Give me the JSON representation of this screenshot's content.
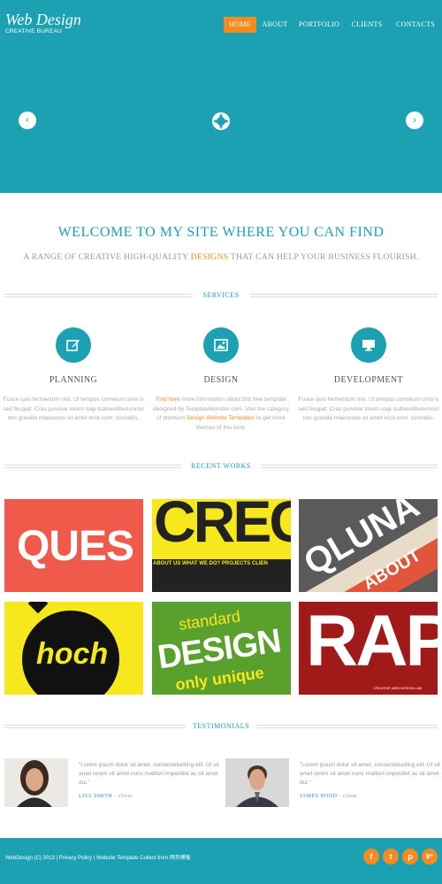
{
  "header": {
    "logo_title": "Web Design",
    "logo_subtitle": "CREATIVE BUREAU",
    "nav": [
      "HOME",
      "ABOUT",
      "PORTFOLIO",
      "CLIENTS",
      "CONTACTS"
    ],
    "active_nav": "HOME"
  },
  "slider": {
    "prev": "‹",
    "next": "›"
  },
  "welcome": {
    "title": "WELCOME TO MY SITE WHERE YOU CAN FIND",
    "sub_before": "A RANGE OF CREATIVE HIGH-QUALITY ",
    "sub_highlight": "DESIGNS",
    "sub_after": " THAT CAN HELP YOUR BUSINESS FLOURISH."
  },
  "services": {
    "heading": "SERVICES",
    "items": [
      {
        "title": "PLANNING",
        "icon": "edit-icon",
        "text": "Fusce quis fermentum nisl. Ut tempus cometum urna is sed feugiat. Cras pulvinar lorem sagi isallvestibulumnisl nec gravida maecenas sit amet eros conr, convallis."
      },
      {
        "title": "DESIGN",
        "icon": "image-icon",
        "link1": "Find here",
        "text_a": " more information about this free template designed by TemplateMonster.com. Visit the category of premium ",
        "link2": "Design Website Templates",
        "text_b": " to get more themes of this kind."
      },
      {
        "title": "DEVELOPMENT",
        "icon": "monitor-icon",
        "text": "Fusce quis fermentum nisl. Ut tempus cometum urna is sed feugiat. Cras pulvinar lorem sagi isallvestibulumnisl nec gravida maecenas sit amet eros conr, convallis."
      }
    ]
  },
  "works": {
    "heading": "RECENT WORKS",
    "items": [
      {
        "text": "QUES",
        "bg": "#f05a4a",
        "fg": "#ffffff"
      },
      {
        "text": "CREC",
        "bg": "#f6e81c",
        "fg": "#222222",
        "nav": "ABOUT US   WHAT WE DO?   PROJECTS   CLIEN"
      },
      {
        "text": "QLUNA",
        "bg": "#444444",
        "fg": "#ffffff",
        "sub": "ABOUT"
      },
      {
        "text": "hoch",
        "bg": "#f6e81c",
        "fg": "#f6e81c"
      },
      {
        "text_top": "standard",
        "text": "DESIGN",
        "text_bottom": "only unique",
        "bg": "#5aa02c",
        "fg": "#ffffff"
      },
      {
        "text": "RAP",
        "bg": "#a01a1a",
        "fg": "#ffffff",
        "caption": "CREATIVE WEB DESIGN LAB"
      }
    ]
  },
  "testimonials": {
    "heading": "TESTIMONIALS",
    "items": [
      {
        "quote": "\"Lorem ipsum dolor sit amet, consecteturding elit. Ut sit amet lorem sit amet nunc mattisrt imperdiet ac sit amet dui.\"",
        "name": "LISA SMITH",
        "role": " - client"
      },
      {
        "quote": "\"Lorem ipsum dolor sit amet, consecteturding elit. Ut sit amet lorem sit amet nunc mattisrt imperdiet ac sit amet dui.\"",
        "name": "JAMES BOND",
        "role": " - client"
      }
    ]
  },
  "footer": {
    "text": "WebDesign (C) 2013 | Privacy Policy | Website Template Collect from 网页模板",
    "social": [
      "f",
      "t",
      "p",
      "g+"
    ]
  },
  "colors": {
    "accent": "#1ba1b2",
    "highlight": "#f58a1f"
  }
}
